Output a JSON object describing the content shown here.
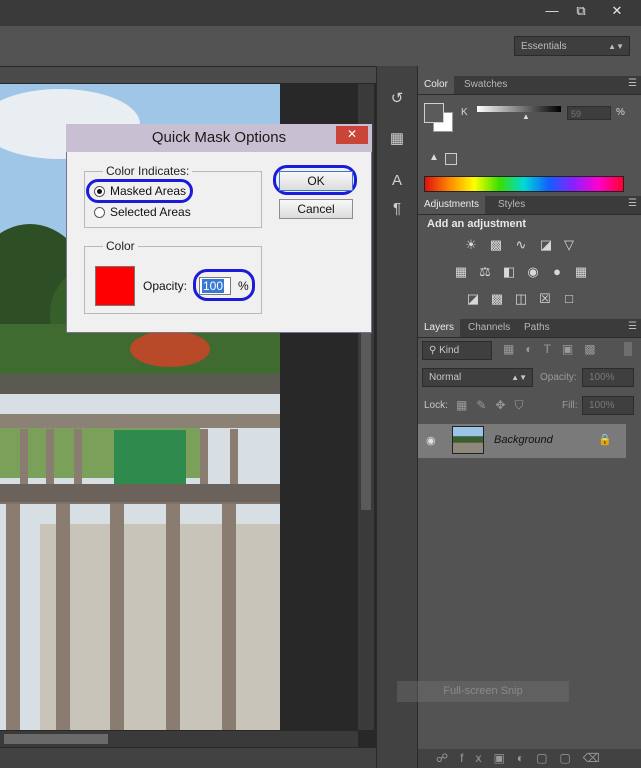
{
  "window": {
    "minimize_glyph": "—",
    "restore_glyph": "⧉",
    "close_glyph": "✕",
    "workspace": "Essentials"
  },
  "dialog": {
    "title": "Quick Mask Options",
    "close_glyph": "✕",
    "color_indicates_legend": "Color Indicates:",
    "masked_areas_label": "Masked Areas",
    "selected_areas_label": "Selected Areas",
    "selected_option": "Masked Areas",
    "color_legend": "Color",
    "swatch_color": "#ff0000",
    "opacity_label": "Opacity:",
    "opacity_value": "100",
    "percent": "%",
    "ok_label": "OK",
    "cancel_label": "Cancel"
  },
  "color_panel": {
    "tabs": [
      "Color",
      "Swatches"
    ],
    "channel_label": "K",
    "channel_value": "59",
    "percent": "%"
  },
  "adjustments_panel": {
    "tabs": [
      "Adjustments",
      "Styles"
    ],
    "heading": "Add an adjustment"
  },
  "layers_panel": {
    "tabs": [
      "Layers",
      "Channels",
      "Paths"
    ],
    "filter_label": "Kind",
    "blend_mode": "Normal",
    "opacity_label": "Opacity:",
    "opacity_value": "100%",
    "lock_label": "Lock:",
    "fill_label": "Fill:",
    "fill_value": "100%",
    "layer_name": "Background"
  },
  "overlay": {
    "snip_label": "Full-screen Snip"
  },
  "icons": {
    "dock": [
      "history-icon",
      "properties-icon",
      "character-icon",
      "paragraph-icon"
    ],
    "adjustments_row1": [
      "brightness-icon",
      "levels-icon",
      "curves-icon",
      "exposure-icon",
      "vibrance-icon"
    ],
    "adjustments_row2": [
      "hue-saturation-icon",
      "color-balance-icon",
      "black-white-icon",
      "photo-filter-icon",
      "channel-mixer-icon",
      "color-lookup-icon"
    ],
    "adjustments_row3": [
      "invert-icon",
      "posterize-icon",
      "threshold-icon",
      "selective-color-icon",
      "gradient-map-icon"
    ]
  }
}
